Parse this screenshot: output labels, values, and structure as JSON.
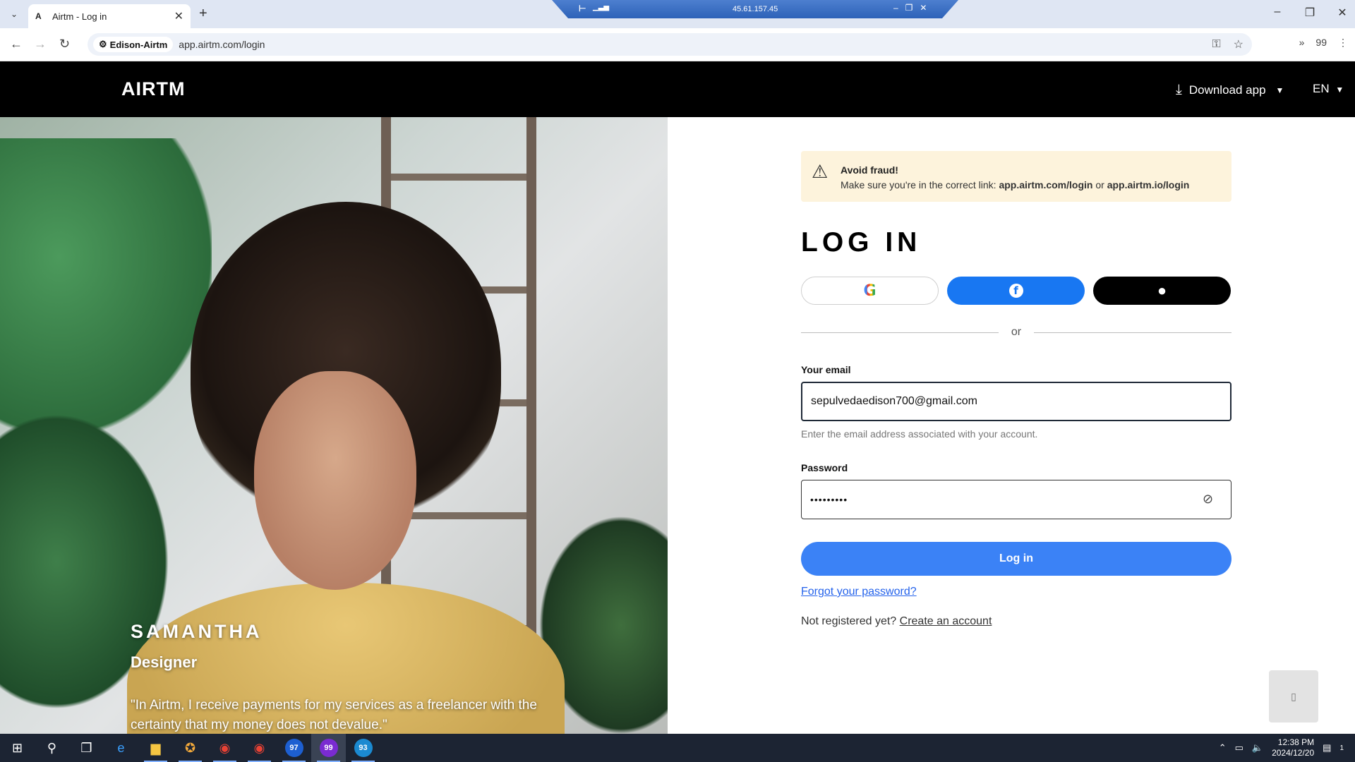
{
  "browser": {
    "tab_title": "Airtm - Log in",
    "tab_favicon": "A",
    "remote_ip": "45.61.157.45",
    "site_chip": "Edison-Airtm",
    "url": "app.airtm.com/login",
    "extensions_count": "99"
  },
  "header": {
    "logo": "AIRTM",
    "download_label": "Download app",
    "language": "EN"
  },
  "hero": {
    "name": "SAMANTHA",
    "role": "Designer",
    "quote": "\"In Airtm, I receive payments for my services as a freelancer with the certainty that my money does not devalue.\""
  },
  "alert": {
    "title": "Avoid fraud!",
    "message_prefix": "Make sure you're in the correct link:",
    "link1": "app.airtm.com/login",
    "or": "or",
    "link2": "app.airtm.io/login"
  },
  "login": {
    "title": "LOG IN",
    "or_text": "or",
    "email_label": "Your email",
    "email_value": "sepulvedaedison700@gmail.com",
    "email_hint": "Enter the email address associated with your account.",
    "password_label": "Password",
    "password_value": "•••••••••",
    "submit_label": "Log in",
    "forgot_label": "Forgot your password?",
    "register_prefix": "Not registered yet?",
    "register_link": "Create an account"
  },
  "taskbar": {
    "badges": [
      "97",
      "99",
      "93"
    ],
    "time": "12:38 PM",
    "date": "2024/12/20",
    "notifications": "1"
  },
  "colors": {
    "brand_black": "#000000",
    "primary_blue": "#3b82f6",
    "facebook_blue": "#1877f2",
    "alert_bg": "#fdf3dc"
  },
  "icons": {
    "alert": "warning-triangle-icon",
    "password_toggle": "eye-off-icon",
    "download": "download-icon"
  }
}
